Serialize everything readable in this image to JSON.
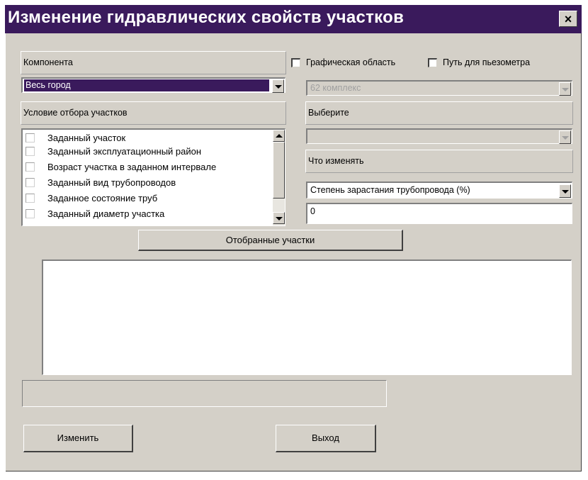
{
  "window": {
    "title": "Изменение гидравлических свойств участков",
    "close_label": "×"
  },
  "left": {
    "component_label": "Компонента",
    "component_value": "Весь город",
    "condition_label": "Условие отбора участков",
    "conditions": [
      {
        "label": "Заданный участок",
        "checked": false
      },
      {
        "label": "Заданный эксплуатационный район",
        "checked": false
      },
      {
        "label": "Возраст участка в заданном интервале",
        "checked": false
      },
      {
        "label": "Заданный вид трубопроводов",
        "checked": false
      },
      {
        "label": "Заданное состояние труб",
        "checked": false
      },
      {
        "label": "Заданный диаметр участка",
        "checked": false
      }
    ]
  },
  "right": {
    "graphic_area_label": "Графическая область",
    "graphic_area_checked": false,
    "piezometer_path_label": "Путь для пьезометра",
    "piezometer_path_checked": false,
    "complex_value": "62 комплекс",
    "choose_label": "Выберите",
    "choose_value": "",
    "what_change_label": "Что изменять",
    "what_change_value": "Степень зарастания трубопровода (%)",
    "change_amount_value": "0"
  },
  "selected_button_label": "Отобранные участки",
  "results_text": "",
  "status_text": "",
  "buttons": {
    "change_label": "Изменить",
    "exit_label": "Выход"
  }
}
